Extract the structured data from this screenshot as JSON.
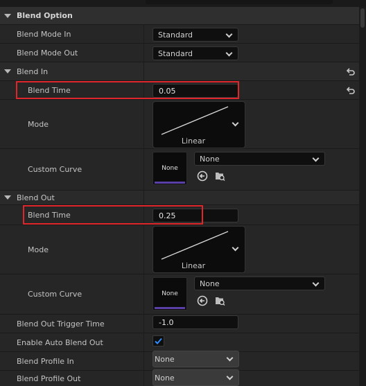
{
  "section": {
    "title": "Blend Option",
    "blend_mode_in": {
      "label": "Blend Mode In",
      "value": "Standard"
    },
    "blend_mode_out": {
      "label": "Blend Mode Out",
      "value": "Standard"
    },
    "blend_in": {
      "title": "Blend In",
      "blend_time": {
        "label": "Blend Time",
        "value": "0.05"
      },
      "mode": {
        "label": "Mode",
        "value": "Linear"
      },
      "custom_curve": {
        "label": "Custom Curve",
        "thumbnail": "None",
        "value": "None"
      }
    },
    "blend_out": {
      "title": "Blend Out",
      "blend_time": {
        "label": "Blend Time",
        "value": "0.25"
      },
      "mode": {
        "label": "Mode",
        "value": "Linear"
      },
      "custom_curve": {
        "label": "Custom Curve",
        "thumbnail": "None",
        "value": "None"
      }
    },
    "blend_out_trigger_time": {
      "label": "Blend Out Trigger Time",
      "value": "-1.0"
    },
    "enable_auto_blend_out": {
      "label": "Enable Auto Blend Out",
      "checked": true
    },
    "blend_profile_in": {
      "label": "Blend Profile In",
      "value": "None"
    },
    "blend_profile_out": {
      "label": "Blend Profile Out",
      "value": "None"
    }
  },
  "icons": {
    "reset": "reset-arrow-icon",
    "use_selected": "use-selected-asset-icon",
    "browse": "browse-asset-icon",
    "checkmark": "checkmark-icon",
    "dropdown": "chevron-down-icon"
  },
  "colors": {
    "highlight": "#e0262b",
    "checkbox_blue": "#2f8cff",
    "thumbnail_bar": "#5b3fa8"
  }
}
